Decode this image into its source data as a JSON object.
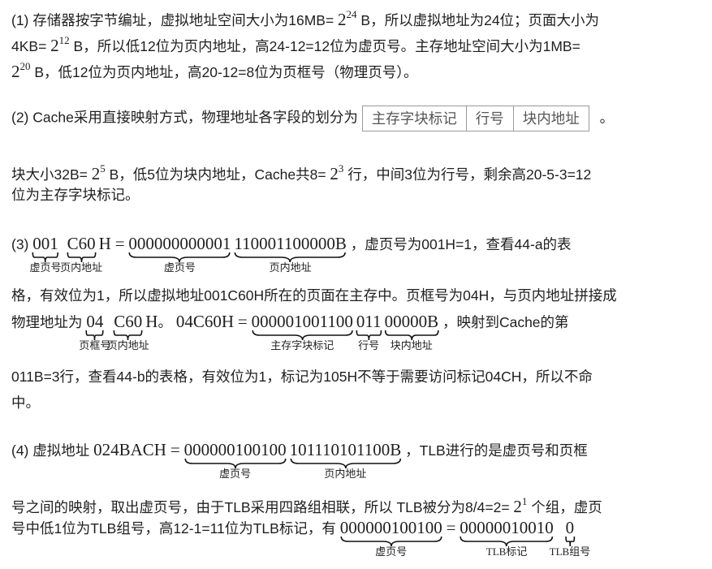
{
  "p1": {
    "l1_a": "(1) 存储器按字节编址，虚拟地址空间大小为16MB= ",
    "l1_b": "2",
    "l1_c": "24",
    "l1_d": " B，所以虚拟地址为24位；页面大小为",
    "l2_a": "4KB= ",
    "l2_b": "2",
    "l2_c": "12",
    "l2_d": " B，所以低12位为页内地址，高24-12=12位为虚页号。主存地址空间大小为1MB=",
    "l3_a": "2",
    "l3_b": "20",
    "l3_c": " B，低12位为页内地址，高20-12=8位为页框号（物理页号）。"
  },
  "p2": {
    "l1_a": "(2) Cache采用直接映射方式，物理地址各字段的划分为",
    "fields": [
      "主存字块标记",
      "行号",
      "块内地址"
    ],
    "l1_b": "。",
    "l2_a": "块大小32B= ",
    "l2_b": "2",
    "l2_c": "5",
    "l2_d": " B，低5位为块内地址，Cache共8= ",
    "l2_e": "2",
    "l2_f": "3",
    "l2_g": " 行，中间3位为行号，剩余高20-5-3=12",
    "l3": "位为主存字块标记。"
  },
  "p3": {
    "prefix": "(3) ",
    "vpn": "001",
    "off": "C60",
    "h": "H",
    "eq": "=",
    "bin1": "000000000001",
    "bin2": "110001100000B",
    "lab_vpn": "虚页号",
    "lab_off": "页内地址",
    "l1_tail": "，虚页号为001H=1，查看44-a的表",
    "l2": "格，有效位为1，所以虚拟地址001C60H所在的页面在主存中。页框号为04H，与页内地址拼接成",
    "l3_a": "物理地址为 ",
    "pfn": "04",
    "off2": "C60",
    "h2": "H",
    "dot": "。",
    "phys": "04C60H",
    "eq2": "=",
    "tag": "000001001100",
    "line": "011",
    "blk": "00000B",
    "lab_pfn": "页框号",
    "lab_off2": "页内地址",
    "lab_tag": "主存字块标记",
    "lab_line": "行号",
    "lab_blk": "块内地址",
    "l3_tail": "，映射到Cache的第",
    "l4": "011B=3行，查看44-b的表格，有效位为1，标记为105H不等于需要访问标记04CH，所以不命",
    "l5": "中。"
  },
  "p4": {
    "prefix": "(4) 虚拟地址 ",
    "va": "024BACH",
    "eq": "=",
    "bin1": "000000100100",
    "bin2": "101110101100B",
    "lab_vpn": "虚页号",
    "lab_off": "页内地址",
    "l1_tail": "，TLB进行的是虚页号和页框",
    "l2_a": "号之间的映射，取出虚页号，由于TLB采用四路组相联，所以 TLB被分为8/4=2= ",
    "l2_b": "2",
    "l2_c": "1",
    "l2_d": " 个组，虚页",
    "l3_a": "号中低1位为TLB组号，高12-1=11位为TLB标记，有 ",
    "vpn": "000000100100",
    "eq2": "=",
    "tlbtag": "00000010010",
    "grp": "0",
    "lab_vpn2": "虚页号",
    "lab_tlbtag": "TLB标记",
    "lab_grp": "TLB组号"
  }
}
